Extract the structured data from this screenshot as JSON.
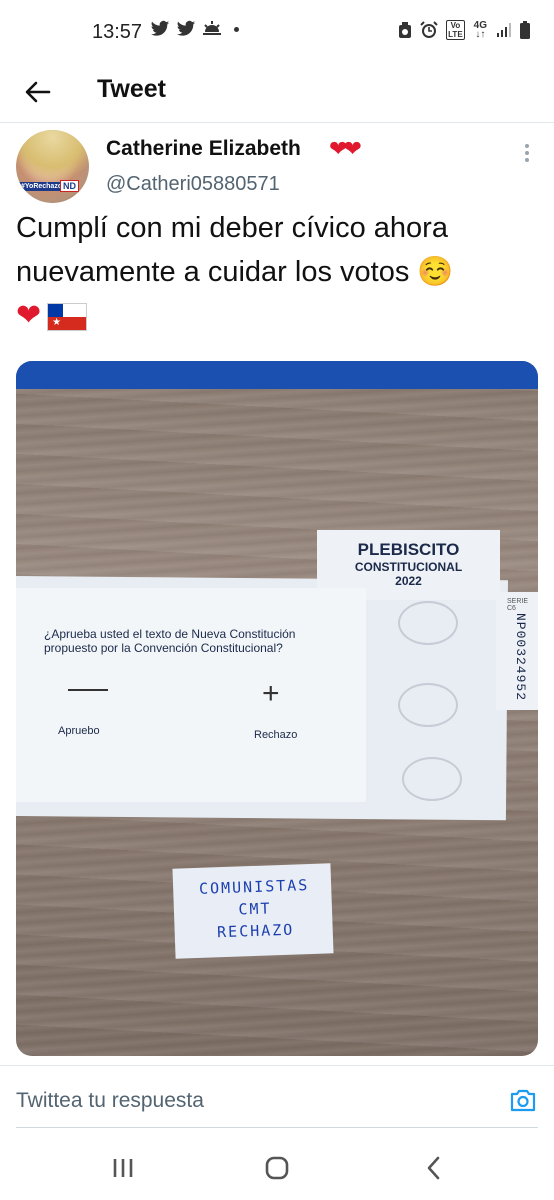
{
  "status_bar": {
    "time": "13:57",
    "left_icons": [
      "twitter-icon",
      "twitter-icon",
      "weather-icon",
      "dot-icon"
    ],
    "right_icons": [
      "alarm-icon",
      "volte-icon",
      "network-4g-icon",
      "signal-icon",
      "battery-icon"
    ],
    "volte_label": "Vo\nLTE",
    "net_label": "4G"
  },
  "header": {
    "title": "Tweet"
  },
  "tweet": {
    "display_name": "Catherine Elizabeth",
    "name_emoji": "❤❤",
    "handle": "@Catheri05880571",
    "avatar_tag_left": "#YoRechazo",
    "avatar_tag_right": "ND",
    "text": "Cumplí con mi deber cívico ahora nuevamente a cuidar los votos ☺️",
    "text_line2_emoji_heart": "❤"
  },
  "media": {
    "ballot": {
      "title": "PLEBISCITO",
      "subtitle": "CONSTITUCIONAL",
      "year": "2022",
      "question_line1": "¿Aprueba usted el texto de Nueva Constitución",
      "question_line2": "propuesto por la Convención Constitucional?",
      "option_approve": "Apruebo",
      "option_reject": "Rechazo",
      "serial_label": "SERIE C6",
      "serial": "NP00324952"
    },
    "note": {
      "line1": "COMUNISTAS",
      "line2": "CMT",
      "line3": "RECHAZO"
    }
  },
  "reply": {
    "placeholder": "Twittea tu respuesta"
  },
  "nav": [
    "recent-apps",
    "home",
    "back"
  ]
}
